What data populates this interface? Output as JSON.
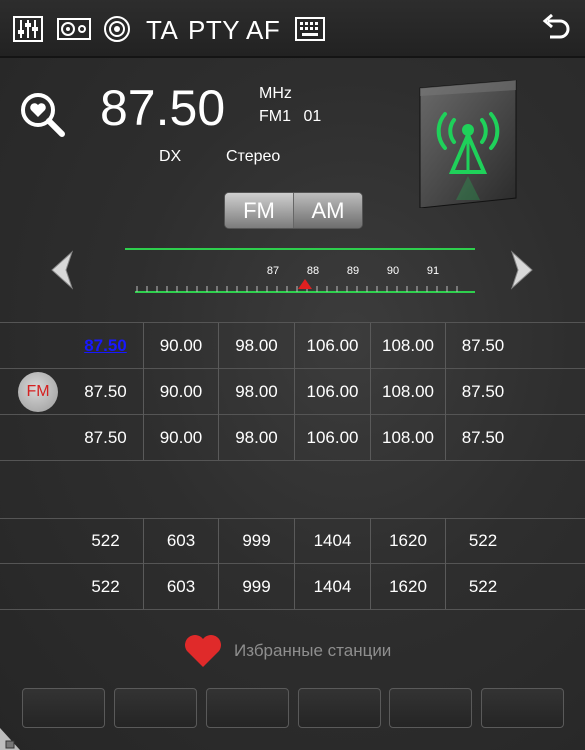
{
  "topbar": {
    "ta_label": "TA",
    "pty_label": "PTY",
    "af_label": "AF",
    "icons": [
      "equalizer-icon",
      "speaker-icon",
      "scan-icon",
      "keyboard-icon",
      "back-icon"
    ]
  },
  "tuner": {
    "frequency": "87.50",
    "unit": "MHz",
    "band_channel": "FM1 01",
    "dx": "DX",
    "stereo": "Стерео",
    "band_fm": "FM",
    "band_am": "AM",
    "scale_labels": [
      "87",
      "88",
      "89",
      "90",
      "91"
    ],
    "marker_value": 87.8
  },
  "fm_presets": {
    "badge": "FM",
    "rows": [
      [
        "87.50",
        "90.00",
        "98.00",
        "106.00",
        "108.00",
        "87.50"
      ],
      [
        "87.50",
        "90.00",
        "98.00",
        "106.00",
        "108.00",
        "87.50"
      ],
      [
        "87.50",
        "90.00",
        "98.00",
        "106.00",
        "108.00",
        "87.50"
      ]
    ]
  },
  "am_presets": {
    "rows": [
      [
        "522",
        "603",
        "999",
        "1404",
        "1620",
        "522"
      ],
      [
        "522",
        "603",
        "999",
        "1404",
        "1620",
        "522"
      ]
    ]
  },
  "favorites": {
    "label": "Избранные станции"
  },
  "colors": {
    "active_preset": "#1818ff",
    "accent_green": "#1fd15a",
    "heart": "#e02a2a",
    "marker": "#e02020"
  }
}
